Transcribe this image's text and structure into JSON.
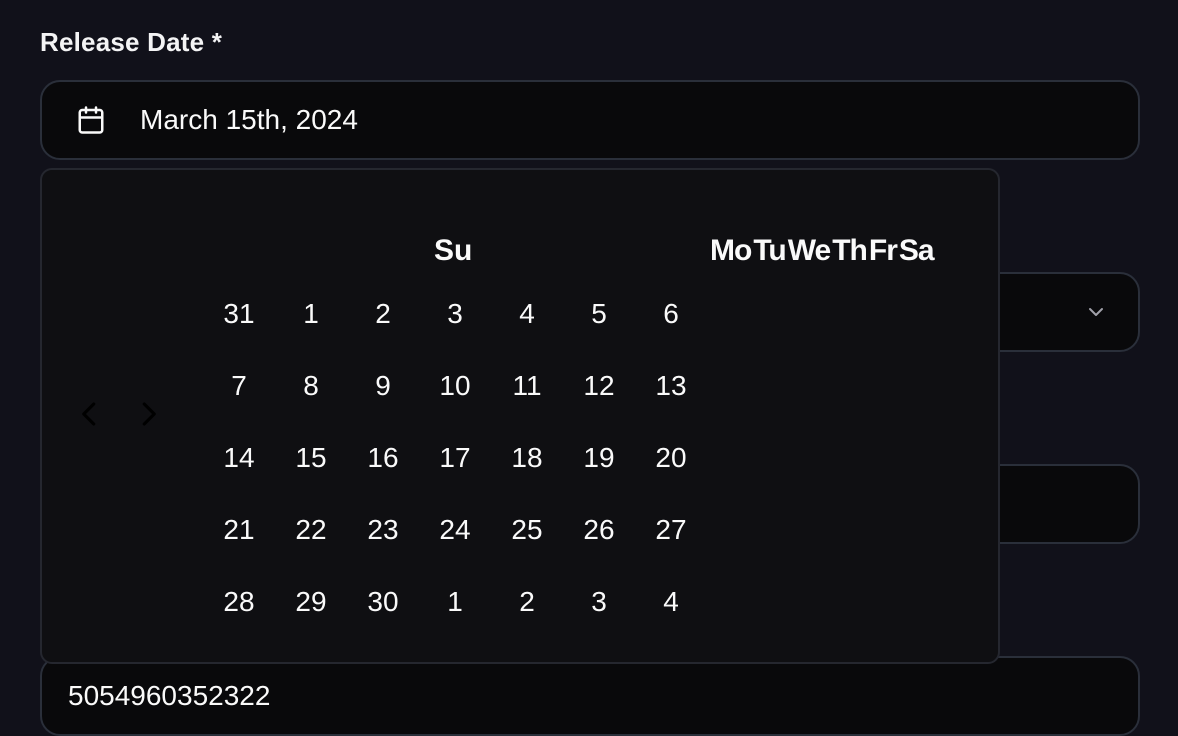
{
  "form": {
    "release_date_label": "Release Date *",
    "release_date_value": "March 15th, 2024",
    "number_value": "5054960352322"
  },
  "calendar": {
    "weekday_first": "Su",
    "weekdays_rest": [
      "Mo",
      "Tu",
      "We",
      "Th",
      "Fr",
      "Sa"
    ],
    "weeks": [
      [
        "31",
        "1",
        "2",
        "3",
        "4",
        "5",
        "6"
      ],
      [
        "7",
        "8",
        "9",
        "10",
        "11",
        "12",
        "13"
      ],
      [
        "14",
        "15",
        "16",
        "17",
        "18",
        "19",
        "20"
      ],
      [
        "21",
        "22",
        "23",
        "24",
        "25",
        "26",
        "27"
      ],
      [
        "28",
        "29",
        "30",
        "1",
        "2",
        "3",
        "4"
      ]
    ],
    "icons": {
      "prev": "chevron-left-icon",
      "next": "chevron-right-icon",
      "field": "calendar-icon",
      "select": "chevron-down-icon"
    }
  },
  "colors": {
    "background": "#11111a",
    "field_bg": "#09090b",
    "border": "#2a2f3a",
    "popover_bg": "#0f0f12",
    "text": "#fafafa"
  }
}
